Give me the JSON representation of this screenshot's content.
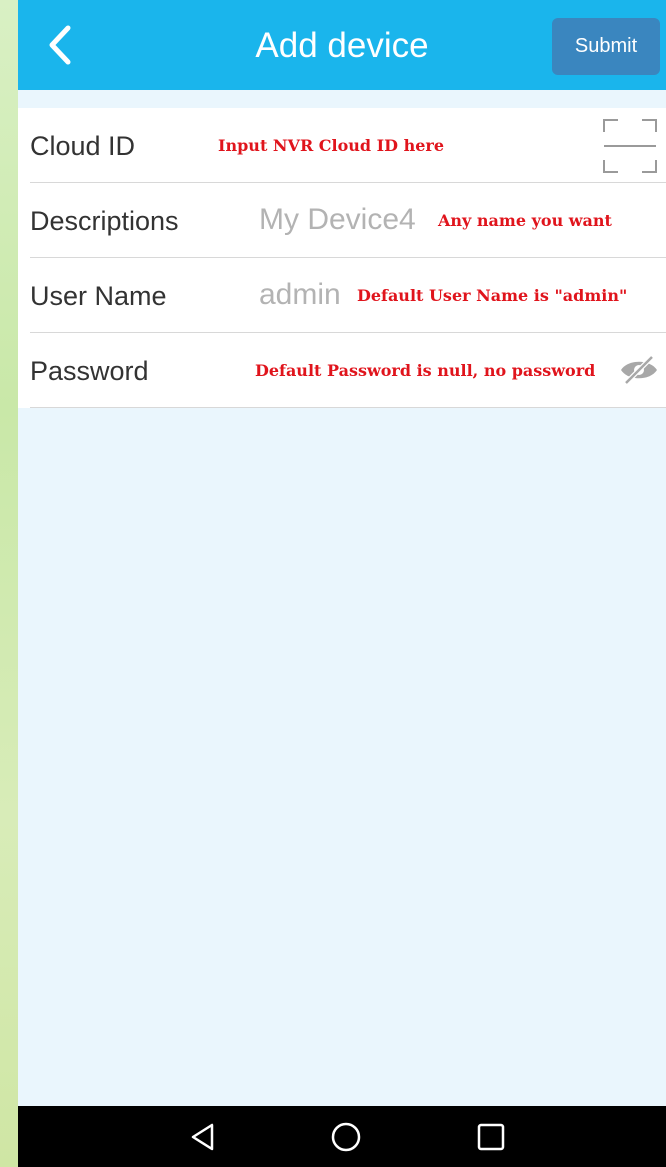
{
  "header": {
    "title": "Add device",
    "submit_label": "Submit",
    "back_icon": "chevron-left-icon",
    "color": "#1ab5ec",
    "submit_color": "#3a86bf"
  },
  "form": {
    "rows": [
      {
        "label": "Cloud ID",
        "value": "",
        "hint": "Input NVR Cloud ID here",
        "icon": "scan-icon"
      },
      {
        "label": "Descriptions",
        "value": "My Device4",
        "hint": "Any name you want"
      },
      {
        "label": "User Name",
        "value": "admin",
        "hint": "Default User Name is \"admin\""
      },
      {
        "label": "Password",
        "value": "",
        "hint": "Default Password is null, no password",
        "icon": "eye-off-icon"
      }
    ],
    "hint_color": "#e0141c"
  },
  "navigation": {
    "buttons": [
      "back-triangle-icon",
      "home-circle-icon",
      "recents-square-icon"
    ]
  }
}
